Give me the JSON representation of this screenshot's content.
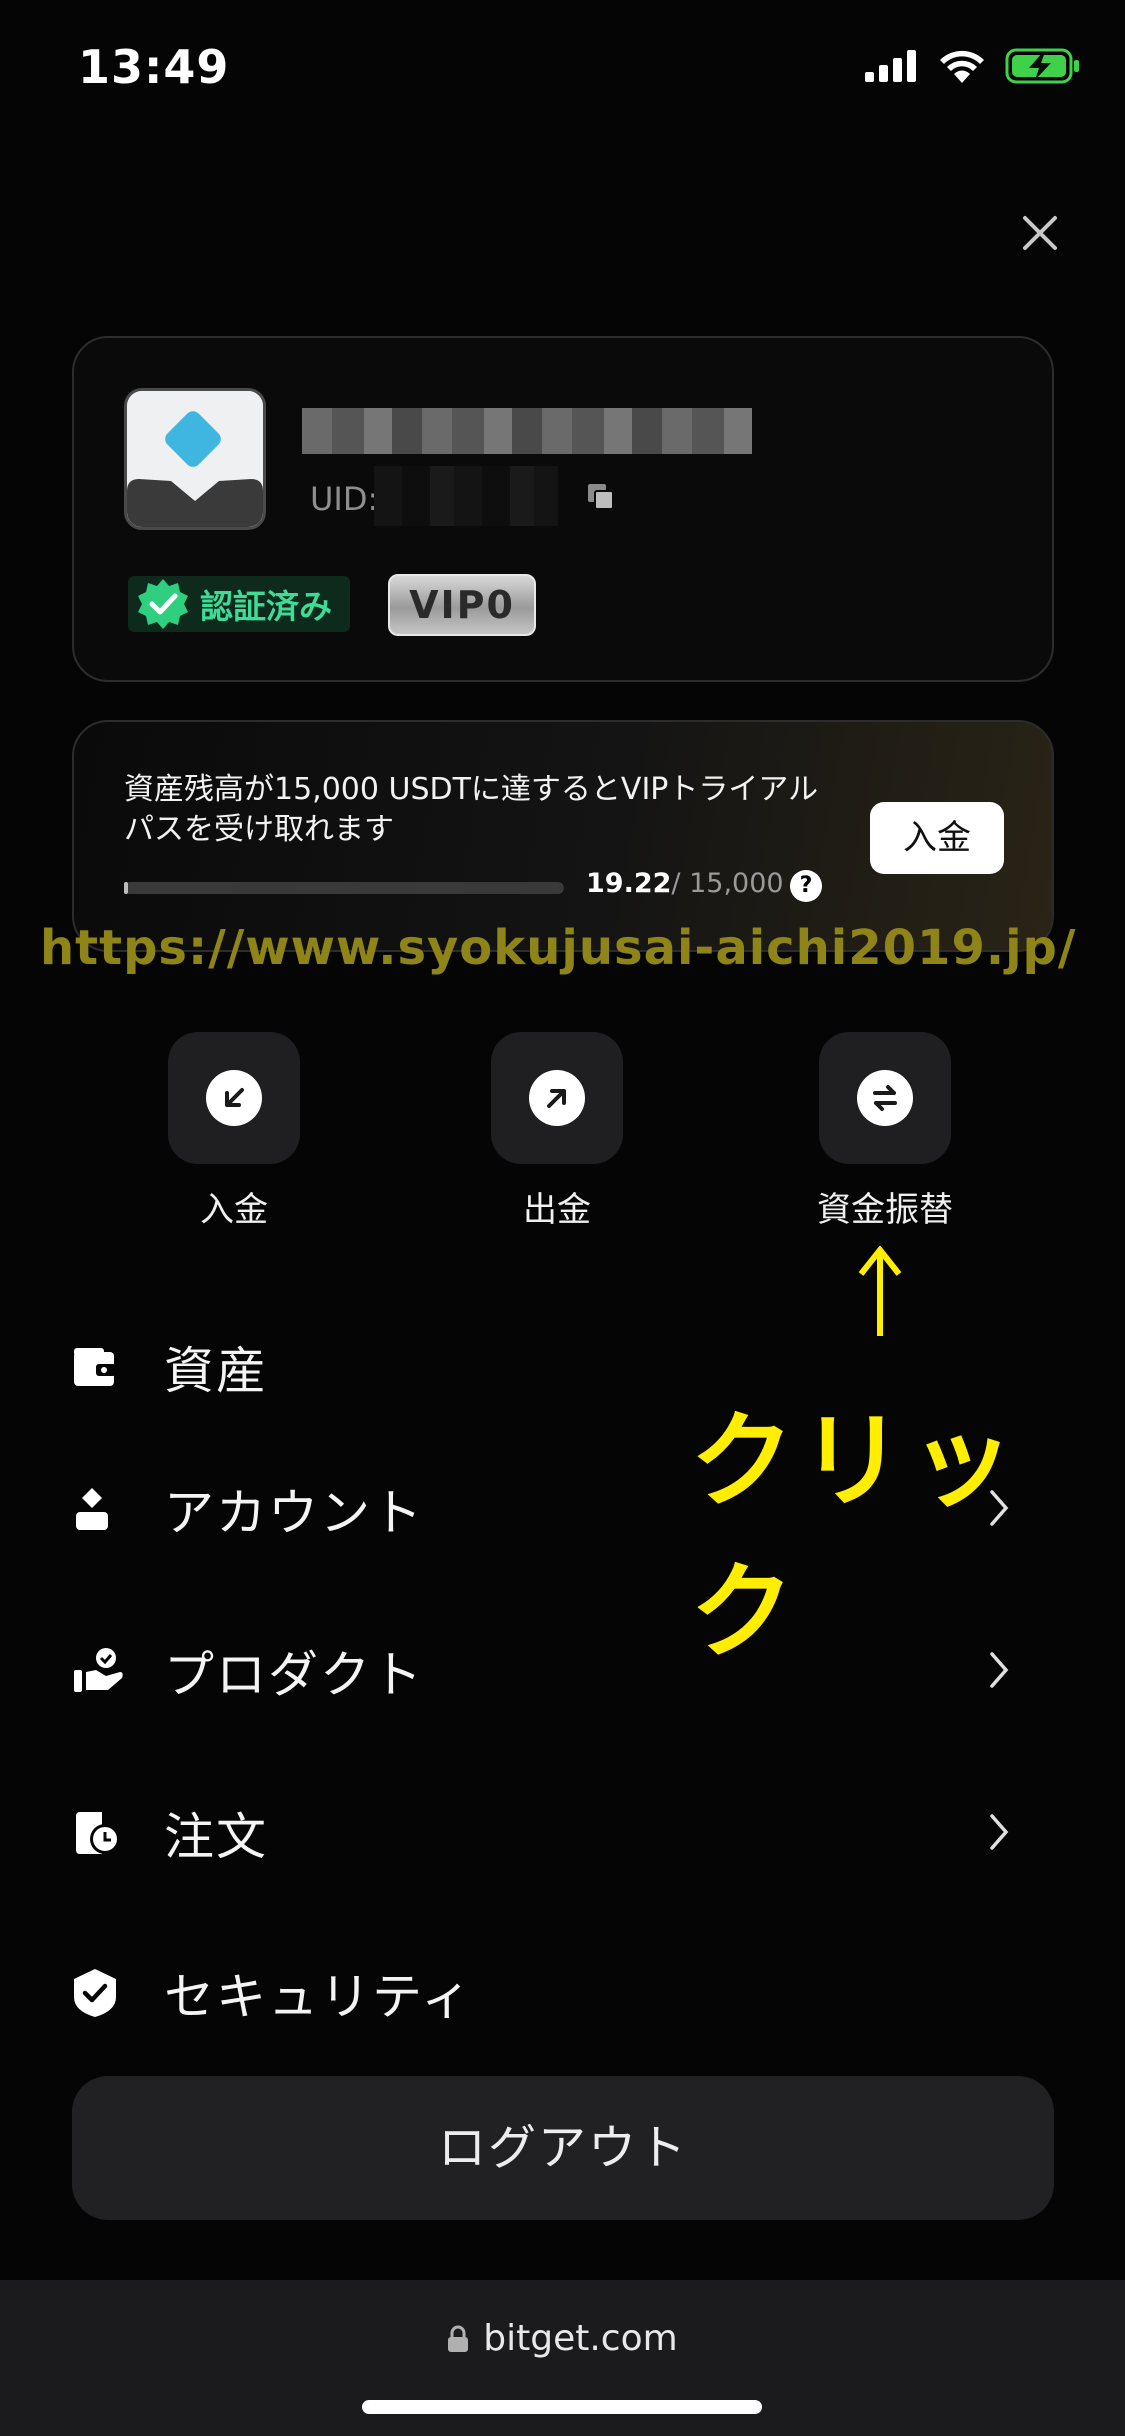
{
  "status_bar": {
    "time": "13:49"
  },
  "profile": {
    "uid_label": "UID:",
    "verified_label": "認証済み",
    "vip_label": "VIP0"
  },
  "vip_trial": {
    "message": "資産残高が15,000 USDTに達するとVIPトライアルパスを受け取れます",
    "progress_current": "19.22",
    "progress_max": "/ 15,000",
    "progress_fraction": 0.0013,
    "help_glyph": "?",
    "deposit_label": "入金"
  },
  "watermark": "https://www.syokujusai-aichi2019.jp/",
  "quick_actions": [
    {
      "label": "入金",
      "icon": "deposit-arrow-icon"
    },
    {
      "label": "出金",
      "icon": "withdraw-arrow-icon"
    },
    {
      "label": "資金振替",
      "icon": "transfer-icon"
    }
  ],
  "annotation": {
    "click_text": "クリック"
  },
  "menu": [
    {
      "label": "資産",
      "icon": "wallet-icon",
      "chevron": false
    },
    {
      "label": "アカウント",
      "icon": "person-icon",
      "chevron": true
    },
    {
      "label": "プロダクト",
      "icon": "product-hand-icon",
      "chevron": true
    },
    {
      "label": "注文",
      "icon": "order-clock-icon",
      "chevron": true
    },
    {
      "label": "セキュリティ",
      "icon": "shield-check-icon",
      "chevron": false
    }
  ],
  "logout_label": "ログアウト",
  "browser": {
    "url": "bitget.com"
  },
  "colors": {
    "verified_green": "#3ddc97",
    "annotation_yellow": "#ffee00",
    "watermark_olive": "#8e8417"
  }
}
